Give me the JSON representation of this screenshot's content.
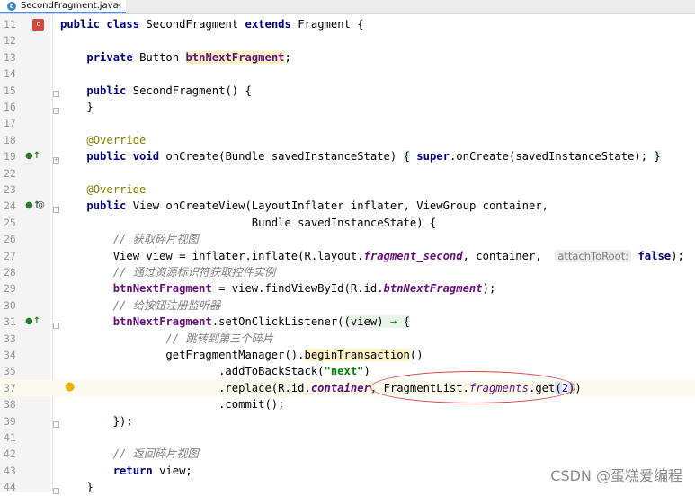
{
  "tab": {
    "icon_letter": "c",
    "filename": "SecondFragment.java",
    "close": "×"
  },
  "code": {
    "comment_get_view": "// 获取碎片视图",
    "comment_find_controls": "// 通过资源标识符获取控件实例",
    "comment_register_listener": "// 给按钮注册监听器",
    "comment_jump_third": "// 跳转到第三个碎片",
    "comment_return_view": "// 返回碎片视图",
    "field_name": "btnNextFragment",
    "class_name": "SecondFragment",
    "parent_class": "Fragment",
    "layout_name": "fragment_second",
    "backstack_string": "\"next\"",
    "hint_label": "attachToRoot:",
    "replace_index": "2"
  },
  "gutter_icons": {
    "line_11": "class-icon",
    "line_19": "override-icon",
    "line_24": "override-icon",
    "line_31": "override-icon",
    "line_37": "intention-bulb-icon"
  },
  "watermark": "CSDN @蛋糕爱编程"
}
